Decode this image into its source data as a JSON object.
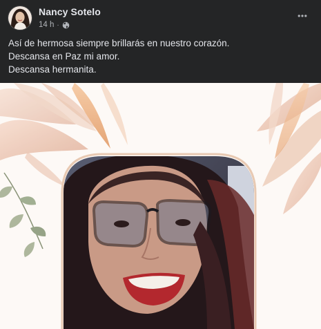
{
  "post": {
    "author": "Nancy Sotelo",
    "time": "14 h",
    "separator": "·",
    "privacy_icon": "globe-icon",
    "more_icon": "more-horizontal-icon",
    "caption_lines": [
      "Así de hermosa siempre brillarás en nuestro corazón.",
      "Descansa en Paz mi amor.",
      "Descansa hermanita."
    ]
  },
  "colors": {
    "background": "#242526",
    "primary_text": "#e4e6eb",
    "secondary_text": "#b0b3b8",
    "media_background": "#fdf9f6",
    "frame_border": "#e8c9b2",
    "leaf_peach": "#e7b59c",
    "leaf_sage": "#9aa98a"
  }
}
